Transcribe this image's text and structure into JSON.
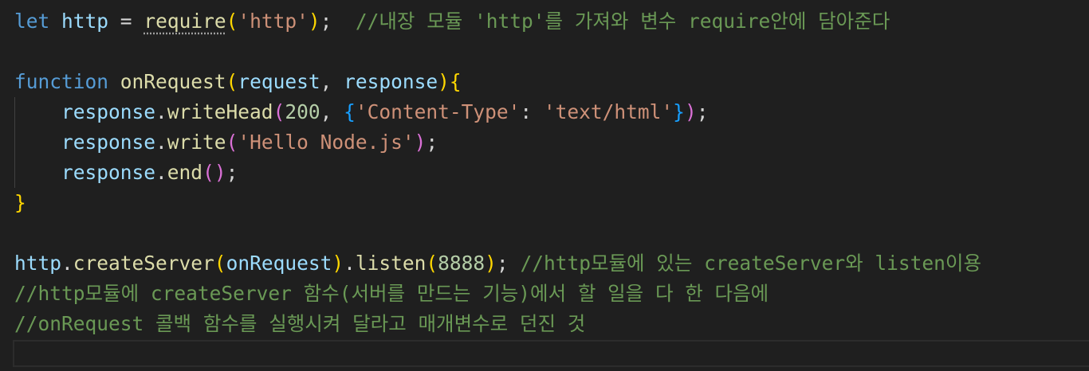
{
  "editor": {
    "lines": [
      {
        "tokens": [
          {
            "t": "let",
            "c": "kw"
          },
          {
            "t": " ",
            "c": "pun"
          },
          {
            "t": "http",
            "c": "var"
          },
          {
            "t": " = ",
            "c": "pun"
          },
          {
            "t": "require",
            "c": "fn squiggle"
          },
          {
            "t": "(",
            "c": "b1"
          },
          {
            "t": "'http'",
            "c": "str"
          },
          {
            "t": ")",
            "c": "b1"
          },
          {
            "t": ";  ",
            "c": "pun"
          },
          {
            "t": "//내장 모듈 'http'를 가져와 변수 require안에 담아준다",
            "c": "cm"
          }
        ]
      },
      {
        "tokens": []
      },
      {
        "tokens": [
          {
            "t": "function",
            "c": "kw"
          },
          {
            "t": " ",
            "c": "pun"
          },
          {
            "t": "onRequest",
            "c": "fn"
          },
          {
            "t": "(",
            "c": "b1"
          },
          {
            "t": "request",
            "c": "var"
          },
          {
            "t": ", ",
            "c": "pun"
          },
          {
            "t": "response",
            "c": "var"
          },
          {
            "t": ")",
            "c": "b1"
          },
          {
            "t": "{",
            "c": "b1"
          }
        ]
      },
      {
        "tokens": [
          {
            "t": "    ",
            "c": "pun"
          },
          {
            "t": "response",
            "c": "var"
          },
          {
            "t": ".",
            "c": "pun"
          },
          {
            "t": "writeHead",
            "c": "fn"
          },
          {
            "t": "(",
            "c": "b2"
          },
          {
            "t": "200",
            "c": "num"
          },
          {
            "t": ", ",
            "c": "pun"
          },
          {
            "t": "{",
            "c": "b3"
          },
          {
            "t": "'Content-Type'",
            "c": "str"
          },
          {
            "t": ": ",
            "c": "pun"
          },
          {
            "t": "'text/html'",
            "c": "str"
          },
          {
            "t": "}",
            "c": "b3"
          },
          {
            "t": ")",
            "c": "b2"
          },
          {
            "t": ";",
            "c": "pun"
          }
        ]
      },
      {
        "tokens": [
          {
            "t": "    ",
            "c": "pun"
          },
          {
            "t": "response",
            "c": "var"
          },
          {
            "t": ".",
            "c": "pun"
          },
          {
            "t": "write",
            "c": "fn"
          },
          {
            "t": "(",
            "c": "b2"
          },
          {
            "t": "'Hello Node.js'",
            "c": "str"
          },
          {
            "t": ")",
            "c": "b2"
          },
          {
            "t": ";",
            "c": "pun"
          }
        ]
      },
      {
        "tokens": [
          {
            "t": "    ",
            "c": "pun"
          },
          {
            "t": "response",
            "c": "var"
          },
          {
            "t": ".",
            "c": "pun"
          },
          {
            "t": "end",
            "c": "fn"
          },
          {
            "t": "(",
            "c": "b2"
          },
          {
            "t": ")",
            "c": "b2"
          },
          {
            "t": ";",
            "c": "pun"
          }
        ]
      },
      {
        "tokens": [
          {
            "t": "}",
            "c": "b1"
          }
        ]
      },
      {
        "tokens": []
      },
      {
        "tokens": [
          {
            "t": "http",
            "c": "var"
          },
          {
            "t": ".",
            "c": "pun"
          },
          {
            "t": "createServer",
            "c": "fn"
          },
          {
            "t": "(",
            "c": "b1"
          },
          {
            "t": "onRequest",
            "c": "var"
          },
          {
            "t": ")",
            "c": "b1"
          },
          {
            "t": ".",
            "c": "pun"
          },
          {
            "t": "listen",
            "c": "fn"
          },
          {
            "t": "(",
            "c": "b1"
          },
          {
            "t": "8888",
            "c": "num"
          },
          {
            "t": ")",
            "c": "b1"
          },
          {
            "t": "; ",
            "c": "pun"
          },
          {
            "t": "//http모듈에 있는 createServer와 listen이용",
            "c": "cm"
          }
        ]
      },
      {
        "tokens": [
          {
            "t": "//http모듈에 createServer 함수(서버를 만드는 기능)에서 할 일을 다 한 다음에",
            "c": "cm"
          }
        ]
      },
      {
        "tokens": [
          {
            "t": "//onRequest 콜백 함수를 실행시켜 달라고 매개변수로 던진 것",
            "c": "cm"
          }
        ]
      }
    ]
  },
  "colors": {
    "background": "#1f1f1f",
    "keyword": "#569cd6",
    "variable": "#9cdcfe",
    "function": "#dcdcaa",
    "string": "#ce9178",
    "number": "#b5cea8",
    "comment": "#6a9955",
    "bracket_level1": "#ffd700",
    "bracket_level2": "#da70d6",
    "bracket_level3": "#179fff"
  }
}
